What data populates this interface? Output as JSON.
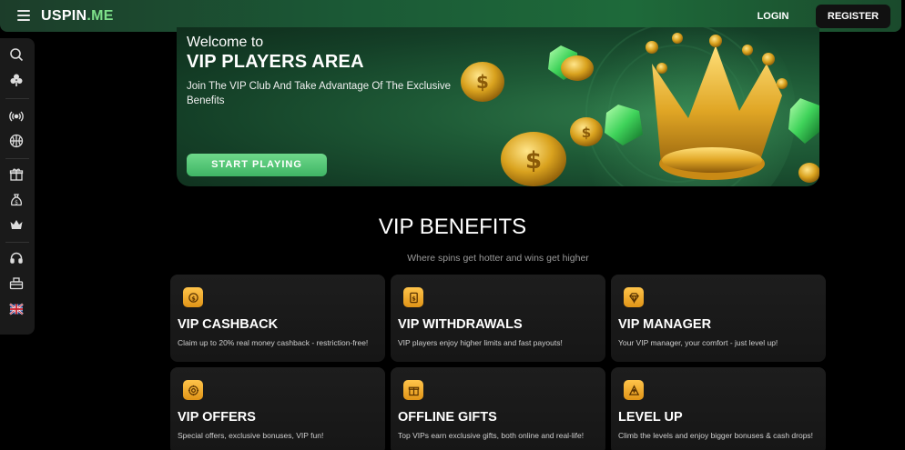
{
  "header": {
    "logo_main": "USPIN",
    "logo_suffix": ".ME",
    "login_label": "LOGIN",
    "register_label": "REGISTER"
  },
  "sidebar": {
    "items": [
      {
        "icon": "search-icon"
      },
      {
        "icon": "club-icon"
      },
      {
        "icon": "live-icon"
      },
      {
        "icon": "basketball-icon"
      },
      {
        "icon": "gift-icon"
      },
      {
        "icon": "money-bag-icon"
      },
      {
        "icon": "crown-icon"
      },
      {
        "icon": "headset-icon"
      },
      {
        "icon": "cashier-icon"
      },
      {
        "icon": "uk-flag-icon"
      }
    ]
  },
  "hero": {
    "welcome": "Welcome to",
    "title": "VIP PLAYERS AREA",
    "subtitle": "Join The VIP Club And Take Advantage Of The Exclusive Benefits",
    "cta_label": "START PLAYING"
  },
  "benefits": {
    "title": "VIP BENEFITS",
    "subtitle": "Where spins get hotter and wins get higher",
    "cards": [
      {
        "icon": "cashback-icon",
        "title": "VIP CASHBACK",
        "desc": "Claim up to 20% real money cashback - restriction-free!"
      },
      {
        "icon": "withdrawal-icon",
        "title": "VIP WITHDRAWALS",
        "desc": "VIP players enjoy higher limits and fast payouts!"
      },
      {
        "icon": "diamond-icon",
        "title": "VIP MANAGER",
        "desc": "Your VIP manager, your comfort - just level up!"
      },
      {
        "icon": "offers-icon",
        "title": "VIP OFFERS",
        "desc": "Special offers, exclusive bonuses, VIP fun!"
      },
      {
        "icon": "gift-box-icon",
        "title": "OFFLINE GIFTS",
        "desc": "Top VIPs earn exclusive gifts, both online and real-life!"
      },
      {
        "icon": "level-up-icon",
        "title": "LEVEL UP",
        "desc": "Climb the levels and enjoy bigger bonuses & cash drops!"
      }
    ]
  },
  "colors": {
    "accent_green": "#3fb565",
    "gold": "#ffc44a",
    "background": "#000000",
    "card": "#1a1a1a"
  }
}
